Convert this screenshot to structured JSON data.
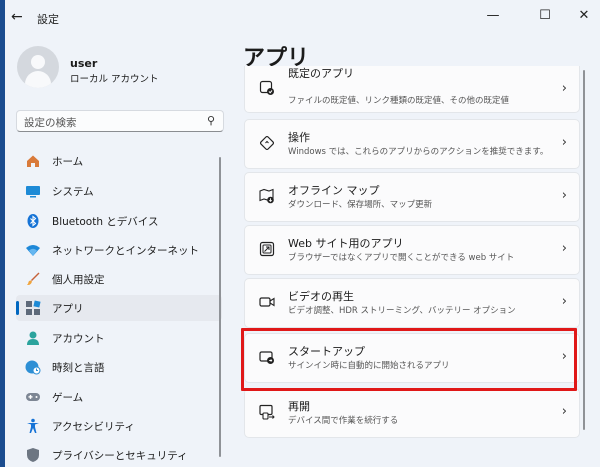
{
  "window": {
    "title": "設定",
    "back_glyph": "←",
    "minimize_glyph": "—",
    "maximize_glyph": "☐",
    "close_glyph": "✕"
  },
  "profile": {
    "name": "user",
    "account": "ローカル アカウント"
  },
  "search": {
    "placeholder": "設定の検索"
  },
  "nav": [
    {
      "label": "ホーム",
      "icon": "home-icon"
    },
    {
      "label": "システム",
      "icon": "system-icon"
    },
    {
      "label": "Bluetooth とデバイス",
      "icon": "bluetooth-icon"
    },
    {
      "label": "ネットワークとインターネット",
      "icon": "wifi-icon"
    },
    {
      "label": "個人用設定",
      "icon": "brush-icon"
    },
    {
      "label": "アプリ",
      "icon": "apps-icon",
      "selected": true
    },
    {
      "label": "アカウント",
      "icon": "account-icon"
    },
    {
      "label": "時刻と言語",
      "icon": "globe-clock-icon"
    },
    {
      "label": "ゲーム",
      "icon": "gamepad-icon"
    },
    {
      "label": "アクセシビリティ",
      "icon": "accessibility-icon"
    },
    {
      "label": "プライバシーとセキュリティ",
      "icon": "shield-icon"
    }
  ],
  "page": {
    "title": "アプリ"
  },
  "cards": [
    {
      "title": "既定のアプリ",
      "desc": "ファイルの既定値、リンク種類の既定値、その他の既定値",
      "icon": "default-apps-icon"
    },
    {
      "title": "操作",
      "desc": "Windows では、これらのアプリからのアクションを推奨できます。",
      "icon": "actions-icon"
    },
    {
      "title": "オフライン マップ",
      "desc": "ダウンロード、保存場所、マップ更新",
      "icon": "offline-maps-icon"
    },
    {
      "title": "Web サイト用のアプリ",
      "desc": "ブラウザーではなくアプリで開くことができる web サイト",
      "icon": "web-apps-icon"
    },
    {
      "title": "ビデオの再生",
      "desc": "ビデオ調整、HDR ストリーミング、バッテリー オプション",
      "icon": "video-icon"
    },
    {
      "title": "スタートアップ",
      "desc": "サインイン時に自動的に開始されるアプリ",
      "icon": "startup-icon",
      "highlighted": true
    },
    {
      "title": "再開",
      "desc": "デバイス間で作業を続行する",
      "icon": "resume-icon"
    }
  ],
  "colors": {
    "accent": "#0067c0",
    "highlight": "#e01818",
    "background": "#eff3f9"
  }
}
